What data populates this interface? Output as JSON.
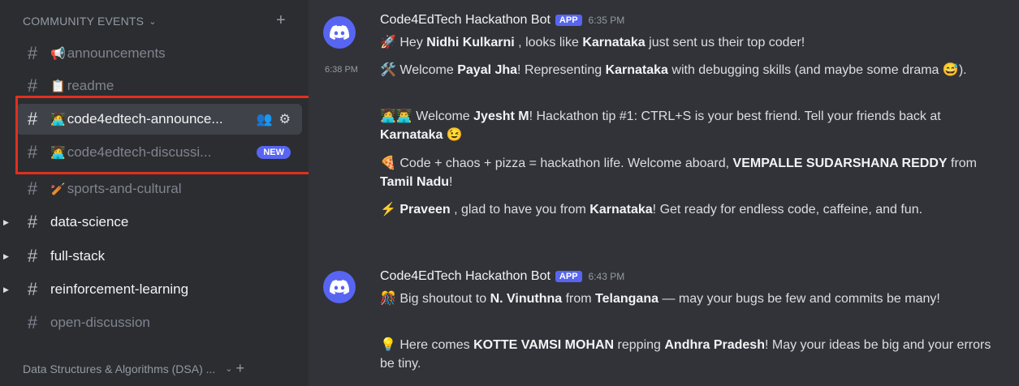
{
  "sidebar": {
    "category": {
      "label": "COMMUNITY EVENTS",
      "chevron": "⌄",
      "plus": "+"
    },
    "channels": [
      {
        "name": "announcements",
        "emoji": "📢"
      },
      {
        "name": "readme",
        "emoji": "📋"
      },
      {
        "name": "code4edtech-announce...",
        "emoji": "🧑‍💻"
      },
      {
        "name": "code4edtech-discussi...",
        "emoji": "🧑‍💻",
        "badge": "NEW"
      },
      {
        "name": "sports-and-cultural",
        "emoji": "🏏"
      },
      {
        "name": "data-science"
      },
      {
        "name": "full-stack"
      },
      {
        "name": "reinforcement-learning"
      },
      {
        "name": "open-discussion"
      }
    ],
    "category2": {
      "label": "Data Structures & Algorithms (DSA) ...",
      "chevron": "⌄",
      "plus": "+"
    },
    "hash": "#",
    "add_member_icon": "👥",
    "gear_icon": "⚙"
  },
  "messages": {
    "group1": {
      "author": "Code4EdTech Hackathon Bot",
      "tag": "APP",
      "time": "6:35 PM",
      "side_time": "6:38 PM",
      "lines": [
        {
          "e": "🚀",
          "parts": [
            "Hey ",
            "Nidhi Kulkarni",
            " , looks like ",
            "Karnataka",
            " just sent us their top coder!"
          ]
        },
        {
          "e": "🛠️",
          "parts": [
            "Welcome ",
            "Payal Jha",
            "! Representing ",
            "Karnataka",
            " with debugging skills (and maybe some drama ",
            "😅",
            ")."
          ]
        },
        {
          "e": "👩‍💻👨‍💻",
          "parts": [
            "Welcome ",
            "Jyesht M",
            "! Hackathon tip #1: CTRL+S is your best friend. Tell your friends back at ",
            "Karnataka",
            " ",
            "😉",
            ""
          ]
        },
        {
          "e": "🍕",
          "parts": [
            "Code + chaos + pizza = hackathon life. Welcome aboard, ",
            "VEMPALLE SUDARSHANA REDDY",
            " from ",
            "Tamil Nadu",
            "!"
          ]
        },
        {
          "e": "⚡",
          "parts": [
            "",
            "Praveen",
            " , glad to have you from ",
            "Karnataka",
            "! Get ready for endless code, caffeine, and fun."
          ]
        }
      ]
    },
    "group2": {
      "author": "Code4EdTech Hackathon Bot",
      "tag": "APP",
      "time": "6:43 PM",
      "lines": [
        {
          "e": "🎊",
          "parts": [
            "Big shoutout to ",
            "N. Vinuthna",
            "  from ",
            "Telangana",
            " — may your bugs be few and commits be many!"
          ]
        },
        {
          "e": "💡",
          "parts": [
            "Here comes ",
            "KOTTE VAMSI MOHAN",
            "  repping ",
            "Andhra Pradesh",
            "! May your ideas be big and your errors be tiny."
          ]
        }
      ]
    }
  },
  "colors": {
    "accent": "#5865f2",
    "highlight": "#e0301e",
    "bg": "#313338",
    "sidebar": "#2b2d31"
  }
}
